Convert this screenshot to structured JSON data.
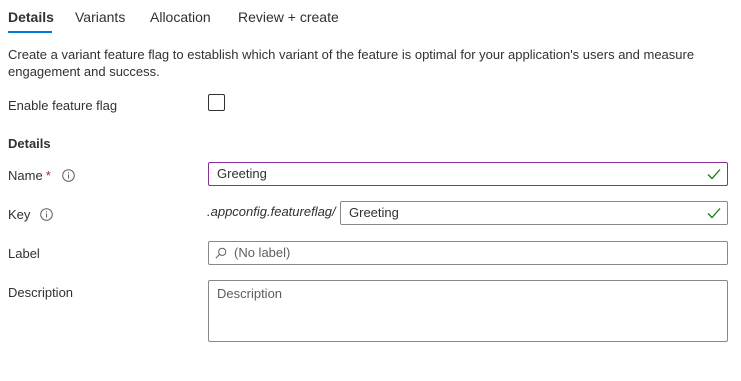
{
  "tabs": [
    {
      "label": "Details",
      "active": true
    },
    {
      "label": "Variants",
      "active": false
    },
    {
      "label": "Allocation",
      "active": false
    },
    {
      "label": "Review + create",
      "active": false
    }
  ],
  "intro_text": "Create a variant feature flag to establish which variant of the feature is optimal for your application's users and measure engagement and success.",
  "enable_flag": {
    "label": "Enable feature flag",
    "checked": false
  },
  "section_title": "Details",
  "name_field": {
    "label": "Name",
    "required_mark": "*",
    "value": "Greeting",
    "valid": true
  },
  "key_field": {
    "label": "Key",
    "prefix": ".appconfig.featureflag/",
    "value": "Greeting",
    "valid": true
  },
  "label_field": {
    "label": "Label",
    "placeholder": "(No label)"
  },
  "description_field": {
    "label": "Description",
    "placeholder": "Description"
  },
  "colors": {
    "accent": "#0078d4",
    "valid_check": "#107c10",
    "required": "#a4262c",
    "focused_border": "#8b2f9f"
  },
  "icons": {
    "info": "info-icon",
    "check": "check-icon",
    "search": "search-icon"
  }
}
